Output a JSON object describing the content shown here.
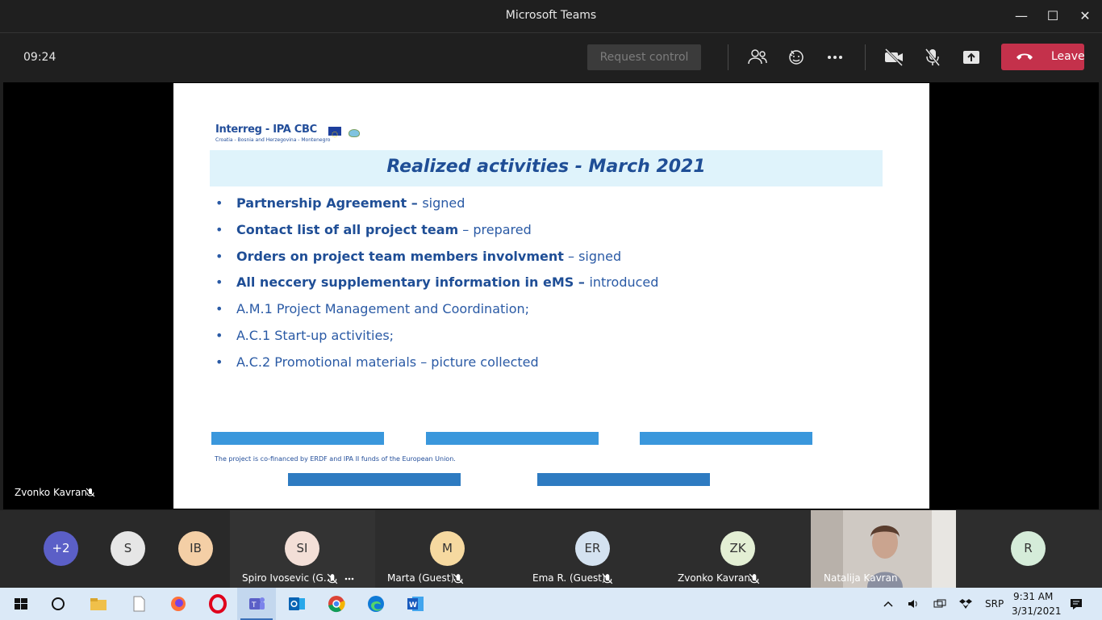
{
  "window": {
    "title": "Microsoft Teams",
    "minimize": "—",
    "maximize": "☐",
    "close": "✕"
  },
  "meeting": {
    "elapsed": "09:24",
    "request_control": "Request control",
    "leave": "Leave"
  },
  "slide": {
    "logo_brand": "Interreg - IPA CBC",
    "logo_sub": "Croatia - Bosnia and Herzegovina - Montenegro",
    "title": "Realized activities - March 2021",
    "bullets": [
      {
        "bold": "Partnership Agreement – ",
        "rest": "signed"
      },
      {
        "bold": "Contact list of all project team",
        "rest": " – prepared"
      },
      {
        "bold": "Orders on project team members involvment",
        "rest": " – signed"
      },
      {
        "bold": "All neccery supplementary information in eMS – ",
        "rest": "introduced"
      },
      {
        "bold": "",
        "rest": "A.M.1 Project Management and Coordination;"
      },
      {
        "bold": "",
        "rest": "A.C.1 Start-up activities;"
      },
      {
        "bold": "",
        "rest": "A.C.2 Promotional materials – picture collected"
      }
    ],
    "footnote": "The project is co-financed by ERDF and IPA II funds of the European Union."
  },
  "presenter": {
    "name": "Zvonko Kavran"
  },
  "gallery": [
    {
      "initials": "+2",
      "color": "#5b5fc7",
      "text_color": "#ffffff",
      "name": ""
    },
    {
      "initials": "S",
      "color": "#e6e6e6",
      "text_color": "#333333",
      "name": ""
    },
    {
      "initials": "IB",
      "color": "#f4cfa6",
      "text_color": "#333333",
      "name": ""
    },
    {
      "initials": "SI",
      "color": "#f3dfd7",
      "text_color": "#333333",
      "name": "Spiro Ivosevic (G..."
    },
    {
      "initials": "M",
      "color": "#f6d9a0",
      "text_color": "#333333",
      "name": "Marta (Guest)"
    },
    {
      "initials": "ER",
      "color": "#d4e2f0",
      "text_color": "#333333",
      "name": "Ema R. (Guest)"
    },
    {
      "initials": "ZK",
      "color": "#e3efd4",
      "text_color": "#333333",
      "name": "Zvonko Kavran"
    },
    {
      "initials": "",
      "color": "",
      "text_color": "",
      "name": "Natalija Kavran"
    },
    {
      "initials": "R",
      "color": "#d5ecd9",
      "text_color": "#333333",
      "name": ""
    }
  ],
  "taskbar": {
    "lang": "SRP",
    "time": "9:31 AM",
    "date": "3/31/2021"
  }
}
